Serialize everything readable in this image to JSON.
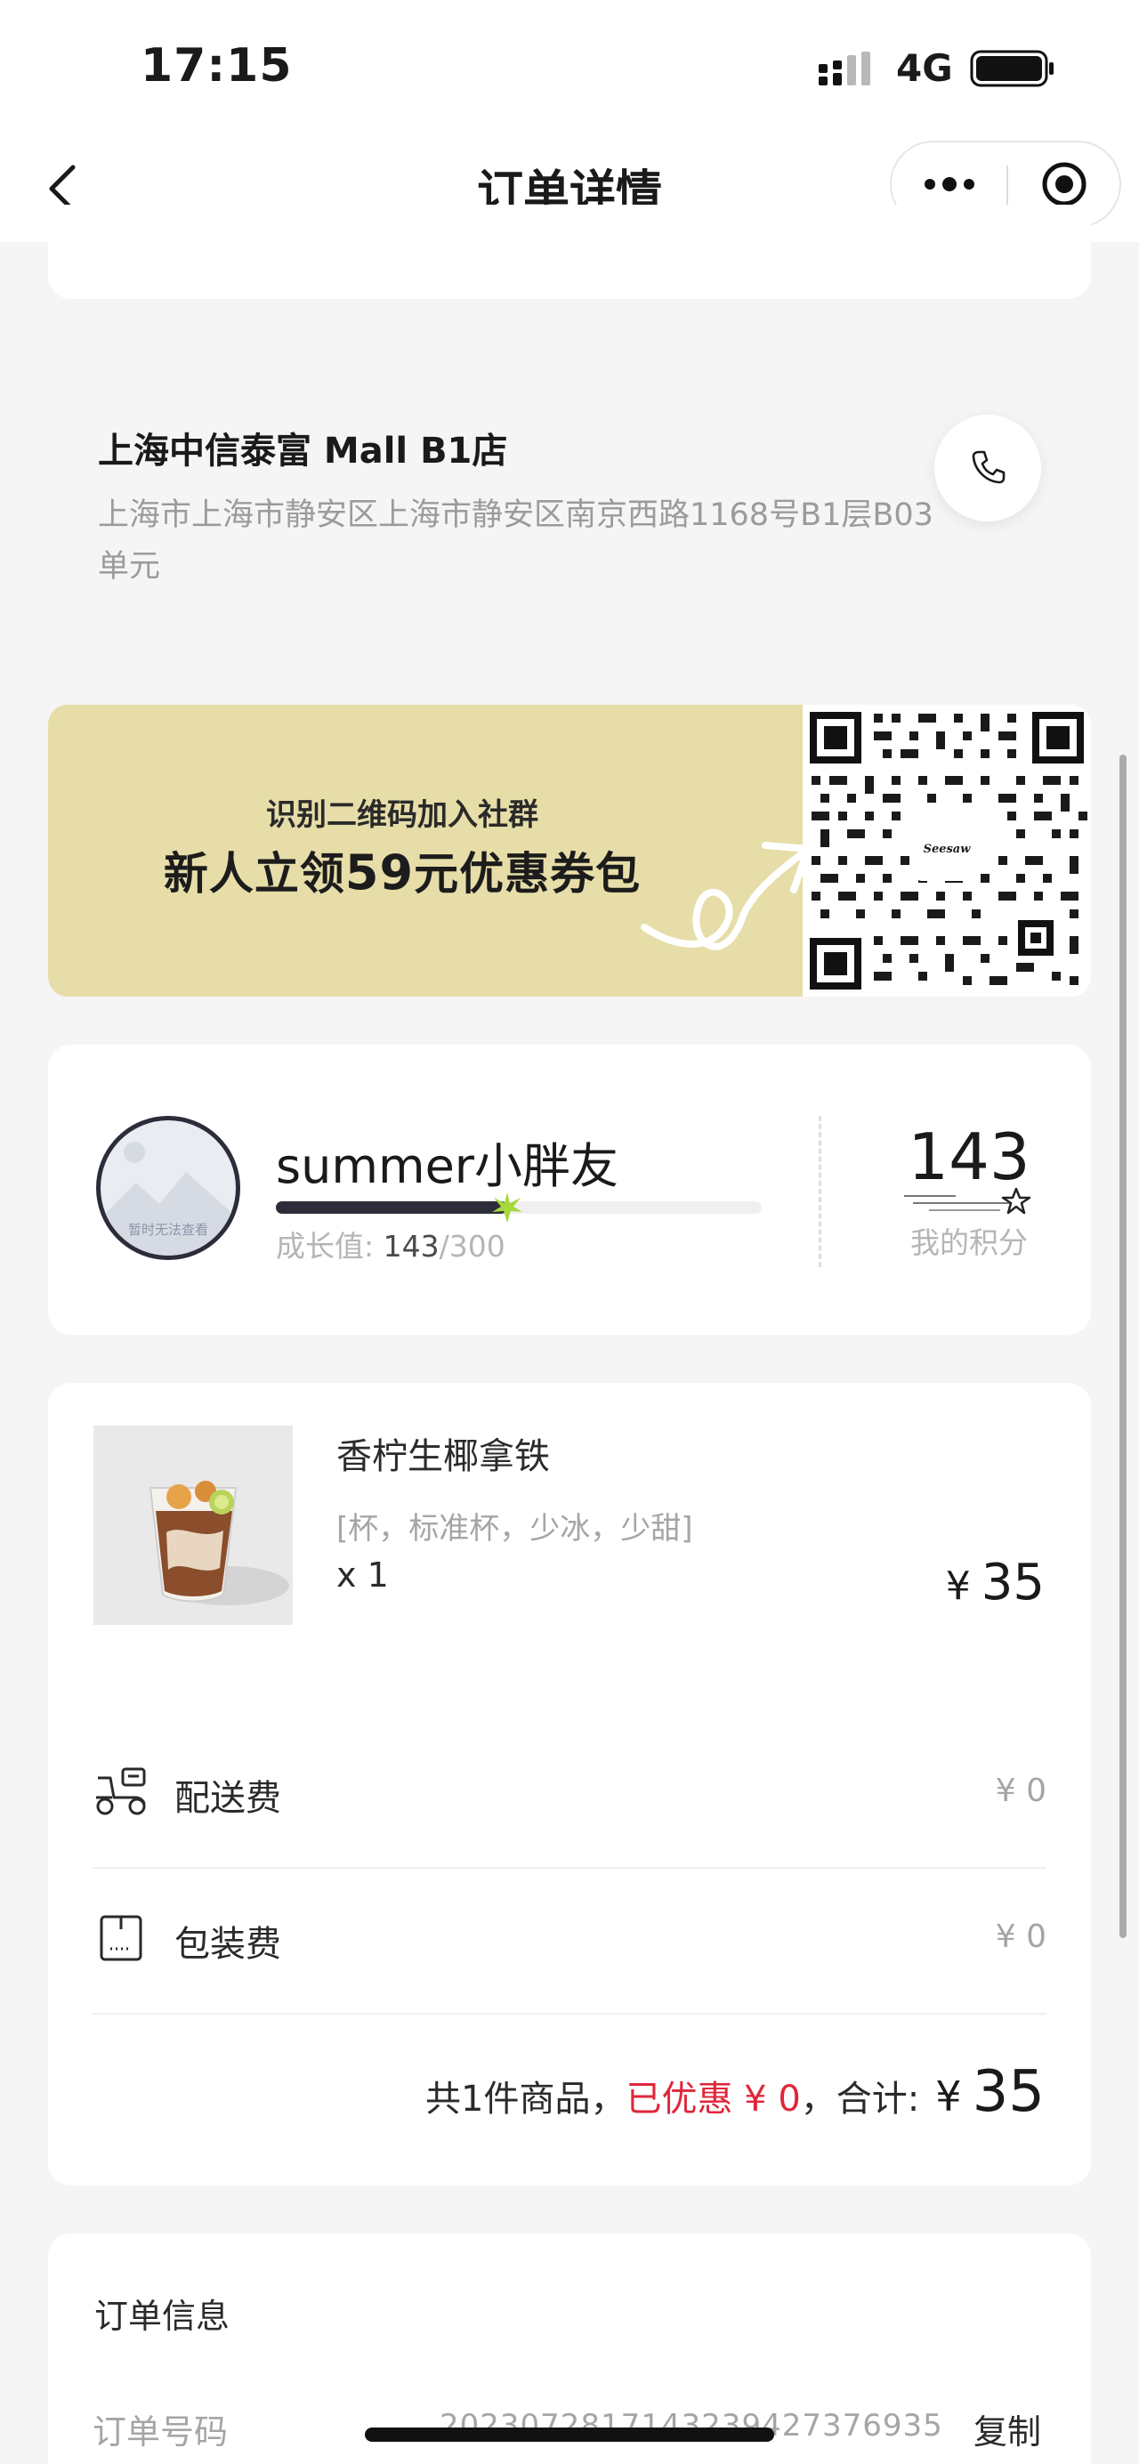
{
  "status_bar": {
    "time": "17:15",
    "network": "4G"
  },
  "nav": {
    "title": "订单详情",
    "back_icon": "chevron-left-icon",
    "more_icon": "ellipsis-icon",
    "close_icon": "target-icon"
  },
  "store": {
    "name": "上海中信泰富 Mall B1店",
    "address": "上海市上海市静安区上海市静安区南京西路1168号B1层B03单元",
    "call_icon": "phone-icon"
  },
  "promo_banner": {
    "line1": "识别二维码加入社群",
    "line2_prefix": "新人立领",
    "line2_amount": "59",
    "line2_suffix": "元优惠券包",
    "qr_logo_text": "Seesaw"
  },
  "member": {
    "avatar_text": "暂时无法查看",
    "name": "summer小胖友",
    "growth_label": "成长值: ",
    "growth_current": "143",
    "growth_total": "/300",
    "growth_progress": 0.477,
    "points": "143",
    "points_label": "我的积分"
  },
  "order": {
    "product": {
      "name": "香柠生椰拿铁",
      "spec": "[杯，标准杯，少冰，少甜]",
      "qty": "x 1",
      "price_currency": "¥",
      "price": "35"
    },
    "fees": [
      {
        "label": "配送费",
        "value": "¥ 0",
        "icon": "scooter-icon"
      },
      {
        "label": "包装费",
        "value": "¥ 0",
        "icon": "package-bag-icon"
      }
    ],
    "summary": {
      "count_text": "共1件商品，",
      "discount_text": "已优惠 ¥ 0",
      "separator": "，",
      "total_label": "合计:",
      "currency": "¥",
      "total": "35"
    }
  },
  "order_info": {
    "title": "订单信息",
    "order_number_label": "订单号码",
    "order_number": "2023072817143239427376935",
    "copy_label": "复制"
  },
  "colors": {
    "accent_red": "#e0263a",
    "banner_bg": "#e6dda8",
    "page_bg": "#f5f5f5"
  }
}
